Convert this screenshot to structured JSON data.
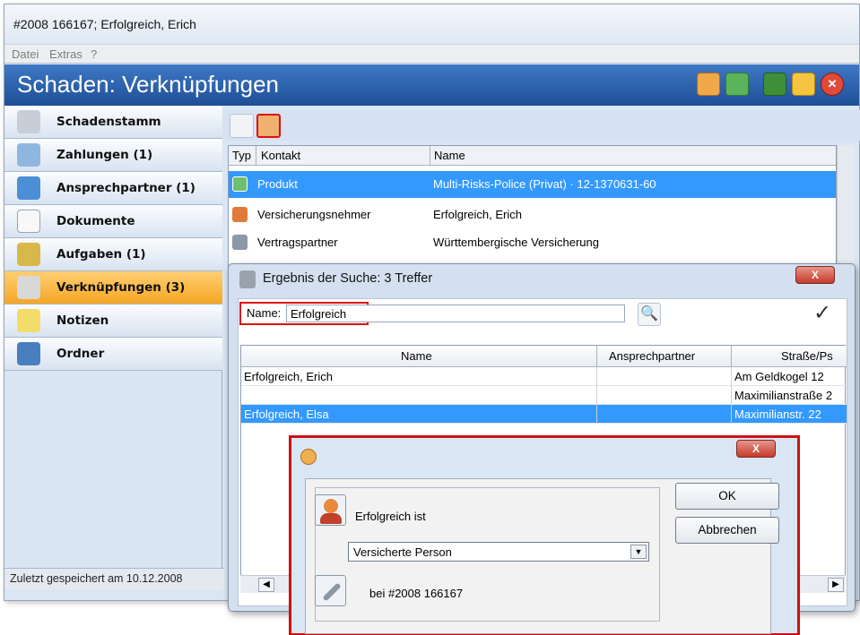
{
  "window": {
    "title": "#2008 166167; Erfolgreich, Erich"
  },
  "menu": [
    "Datei",
    "Extras",
    "?"
  ],
  "header": {
    "title": "Schaden: Verknüpfungen"
  },
  "header_icons": [
    "add-person-icon",
    "export-icon",
    "save-icon",
    "move-icon",
    "close-icon"
  ],
  "sidebar": {
    "items": [
      {
        "label": "Schadenstamm",
        "icon": "wrench-icon"
      },
      {
        "label": "Zahlungen (1)",
        "icon": "payment-icon"
      },
      {
        "label": "Ansprechpartner (1)",
        "icon": "person-icon"
      },
      {
        "label": "Dokumente",
        "icon": "document-icon"
      },
      {
        "label": "Aufgaben (1)",
        "icon": "task-icon"
      },
      {
        "label": "Verknüpfungen (3)",
        "icon": "link-icon",
        "active": true
      },
      {
        "label": "Notizen",
        "icon": "note-icon"
      },
      {
        "label": "Ordner",
        "icon": "folder-icon"
      }
    ]
  },
  "status": {
    "text": "Zuletzt gespeichert am 10.12.2008"
  },
  "links_table": {
    "columns": [
      "Typ",
      "Kontakt",
      "Name"
    ],
    "rows": [
      {
        "icon": "product-icon",
        "kontakt": "Produkt",
        "name": "Multi-Risks-Police (Privat) · 12-1370631-60",
        "selected": true
      },
      {
        "icon": "person-icon",
        "kontakt": "Versicherungsnehmer",
        "name": "Erfolgreich, Erich"
      },
      {
        "icon": "company-icon",
        "kontakt": "Vertragspartner",
        "name": "Württembergische Versicherung"
      }
    ]
  },
  "search_dialog": {
    "title": "Ergebnis der Suche: 3 Treffer",
    "close_label": "X",
    "name_label": "Name:",
    "name_value": "Erfolgreich",
    "columns": [
      "Name",
      "Ansprechpartner",
      "Straße/Ps"
    ],
    "rows": [
      {
        "name": "Erfolgreich, Erich",
        "ansprechpartner": "",
        "strasse": "Am Geldkogel 12"
      },
      {
        "name": "",
        "ansprechpartner": "",
        "strasse": "Maximilianstraße 2"
      },
      {
        "name": "Erfolgreich, Elsa",
        "ansprechpartner": "",
        "strasse": "Maximilianstr. 22",
        "selected": true
      }
    ]
  },
  "role_dialog": {
    "close_label": "X",
    "text": "Erfolgreich ist",
    "role_value": "Versicherte Person",
    "ref_text": "bei #2008 166167",
    "ok_label": "OK",
    "cancel_label": "Abbrechen"
  },
  "colors": {
    "accent": "#3399ff",
    "header": "#2a5ea8",
    "active_nav": "#f5a623",
    "highlight": "#dd1111"
  }
}
